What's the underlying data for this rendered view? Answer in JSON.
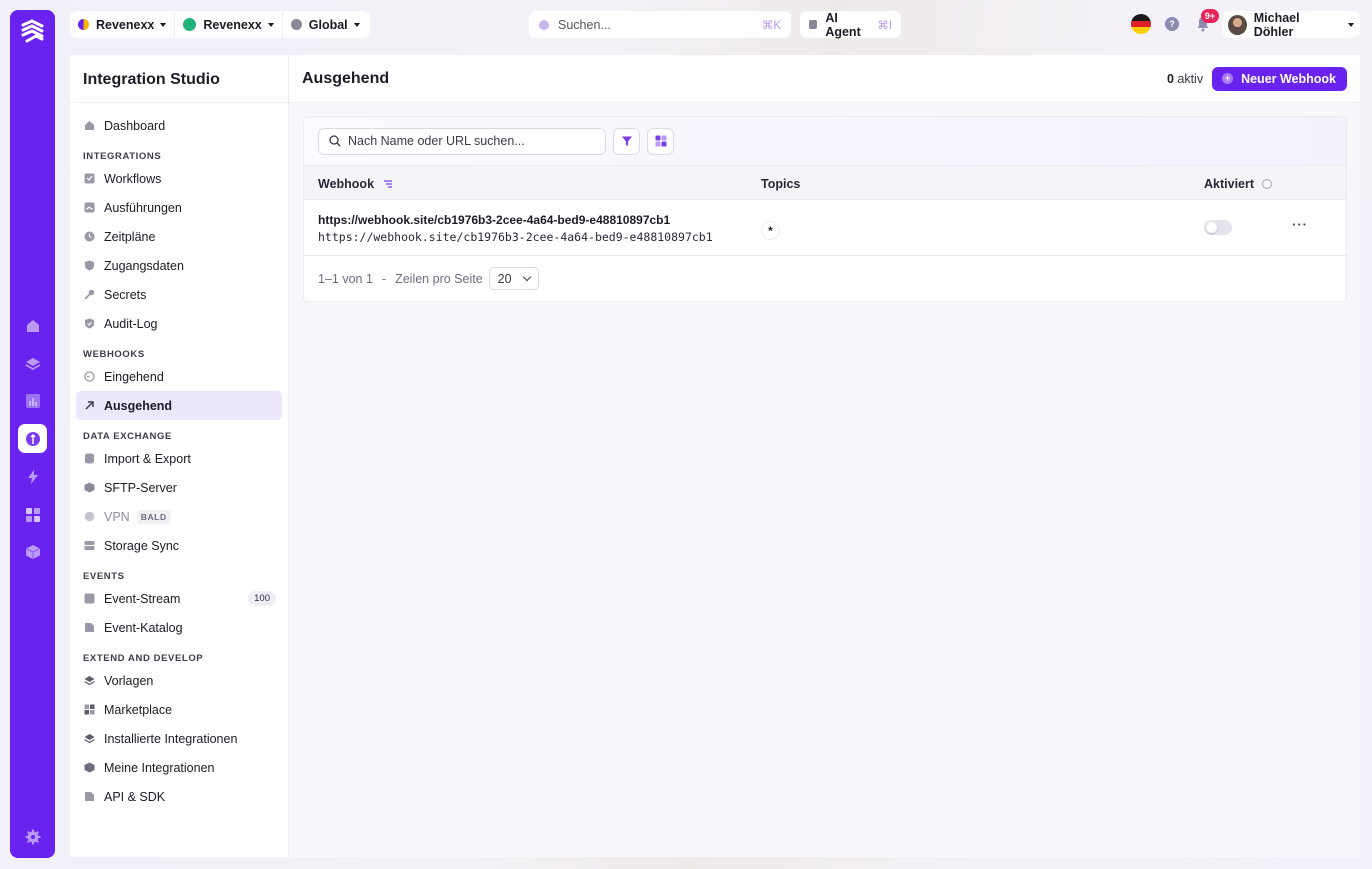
{
  "topbar": {
    "org": "Revenexx",
    "workspace": "Revenexx",
    "region": "Global",
    "search_placeholder": "Suchen...",
    "search_shortcut": "⌘K",
    "agent_label": "AI Agent",
    "agent_shortcut": "⌘I",
    "help": "?",
    "notifications": "9+",
    "user_name": "Michael Döhler"
  },
  "colors": {
    "accent": "#6a23ee",
    "active_bg": "#ece7fb",
    "badge": "#e8245a"
  },
  "sidebar": {
    "title": "Integration Studio",
    "dashboard": "Dashboard",
    "integrations_title": "INTEGRATIONS",
    "integrations": [
      "Workflows",
      "Ausführungen",
      "Zeitpläne",
      "Zugangsdaten",
      "Secrets",
      "Audit-Log"
    ],
    "webhooks_title": "WEBHOOKS",
    "webhooks": [
      "Eingehend",
      "Ausgehend"
    ],
    "exchange_title": "DATA EXCHANGE",
    "exchange": [
      "Import & Export",
      "SFTP-Server",
      "VPN",
      "Storage Sync"
    ],
    "vpn_badge": "BALD",
    "events_title": "EVENTS",
    "events": [
      "Event-Stream",
      "Event-Katalog"
    ],
    "events_count": "100",
    "extend_title": "EXTEND AND DEVELOP",
    "extend": [
      "Vorlagen",
      "Marketplace",
      "Installierte Integrationen",
      "Meine Integrationen",
      "API & SDK"
    ]
  },
  "main": {
    "title": "Ausgehend",
    "active_count": "0",
    "active_label": "aktiv",
    "new_button": "Neuer Webhook",
    "search_placeholder": "Nach Name oder URL suchen...",
    "columns": {
      "webhook": "Webhook",
      "topics": "Topics",
      "enabled": "Aktiviert"
    },
    "rows": [
      {
        "name": "https://webhook.site/cb1976b3-2cee-4a64-bed9-e48810897cb1",
        "url": "https://webhook.site/cb1976b3-2cee-4a64-bed9-e48810897cb1",
        "topic": "*",
        "enabled": false,
        "more": "···"
      }
    ],
    "pager": {
      "range": "1–1 von 1",
      "sep": "-",
      "rows_label": "Zeilen pro Seite",
      "rows_value": "20"
    }
  }
}
